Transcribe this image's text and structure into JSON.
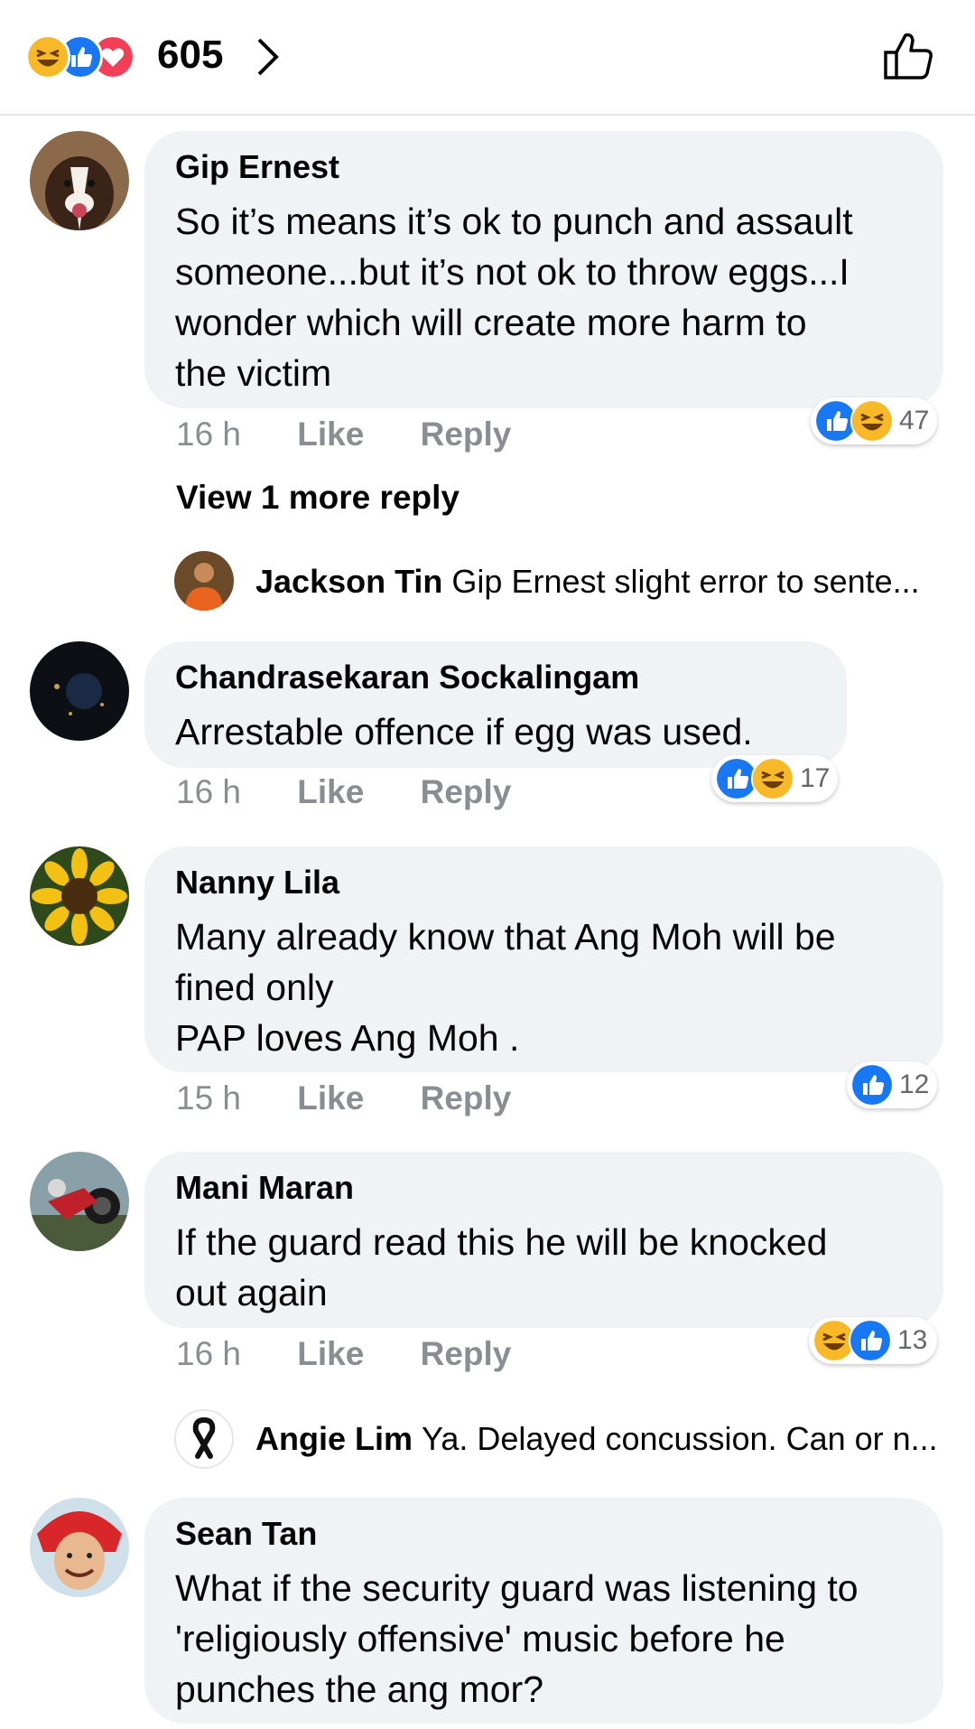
{
  "header": {
    "reaction_count": "605",
    "reactions": [
      "haha-icon",
      "like-icon",
      "love-icon"
    ]
  },
  "comments": [
    {
      "author": "Gip Ernest",
      "text": "So it’s means it’s ok to punch and assault\nsomeone...but it’s not ok to throw eggs...I\nwonder which will create more harm to\nthe victim",
      "time": "16 h",
      "like_label": "Like",
      "reply_label": "Reply",
      "reaction_count": "47",
      "view_more": "View 1 more reply",
      "reply_preview": {
        "author": "Jackson Tin",
        "text": "Gip Ernest slight error to sente..."
      }
    },
    {
      "author": "Chandrasekaran Sockalingam",
      "text": "Arrestable offence  if egg was used.",
      "time": "16 h",
      "like_label": "Like",
      "reply_label": "Reply",
      "reaction_count": "17"
    },
    {
      "author": "Nanny Lila",
      "text": "Many already know that Ang Moh will be\nfined only\nPAP loves  Ang Moh .",
      "time": "15 h",
      "like_label": "Like",
      "reply_label": "Reply",
      "reaction_count": "12"
    },
    {
      "author": "Mani Maran",
      "text": "If the guard read this he will be knocked\nout again",
      "time": "16 h",
      "like_label": "Like",
      "reply_label": "Reply",
      "reaction_count": "13",
      "reply_preview": {
        "author": "Angie Lim",
        "text": "Ya. Delayed concussion. Can or n..."
      }
    },
    {
      "author": "Sean Tan",
      "text": "What if the security guard was listening to\n'religiously offensive' music before he\npunches the ang mor?"
    }
  ],
  "colors": {
    "like": "#1877f2",
    "haha": "#f7b928",
    "love": "#f33e58",
    "bubble": "#f0f2f5",
    "meta": "#8a8d91"
  }
}
